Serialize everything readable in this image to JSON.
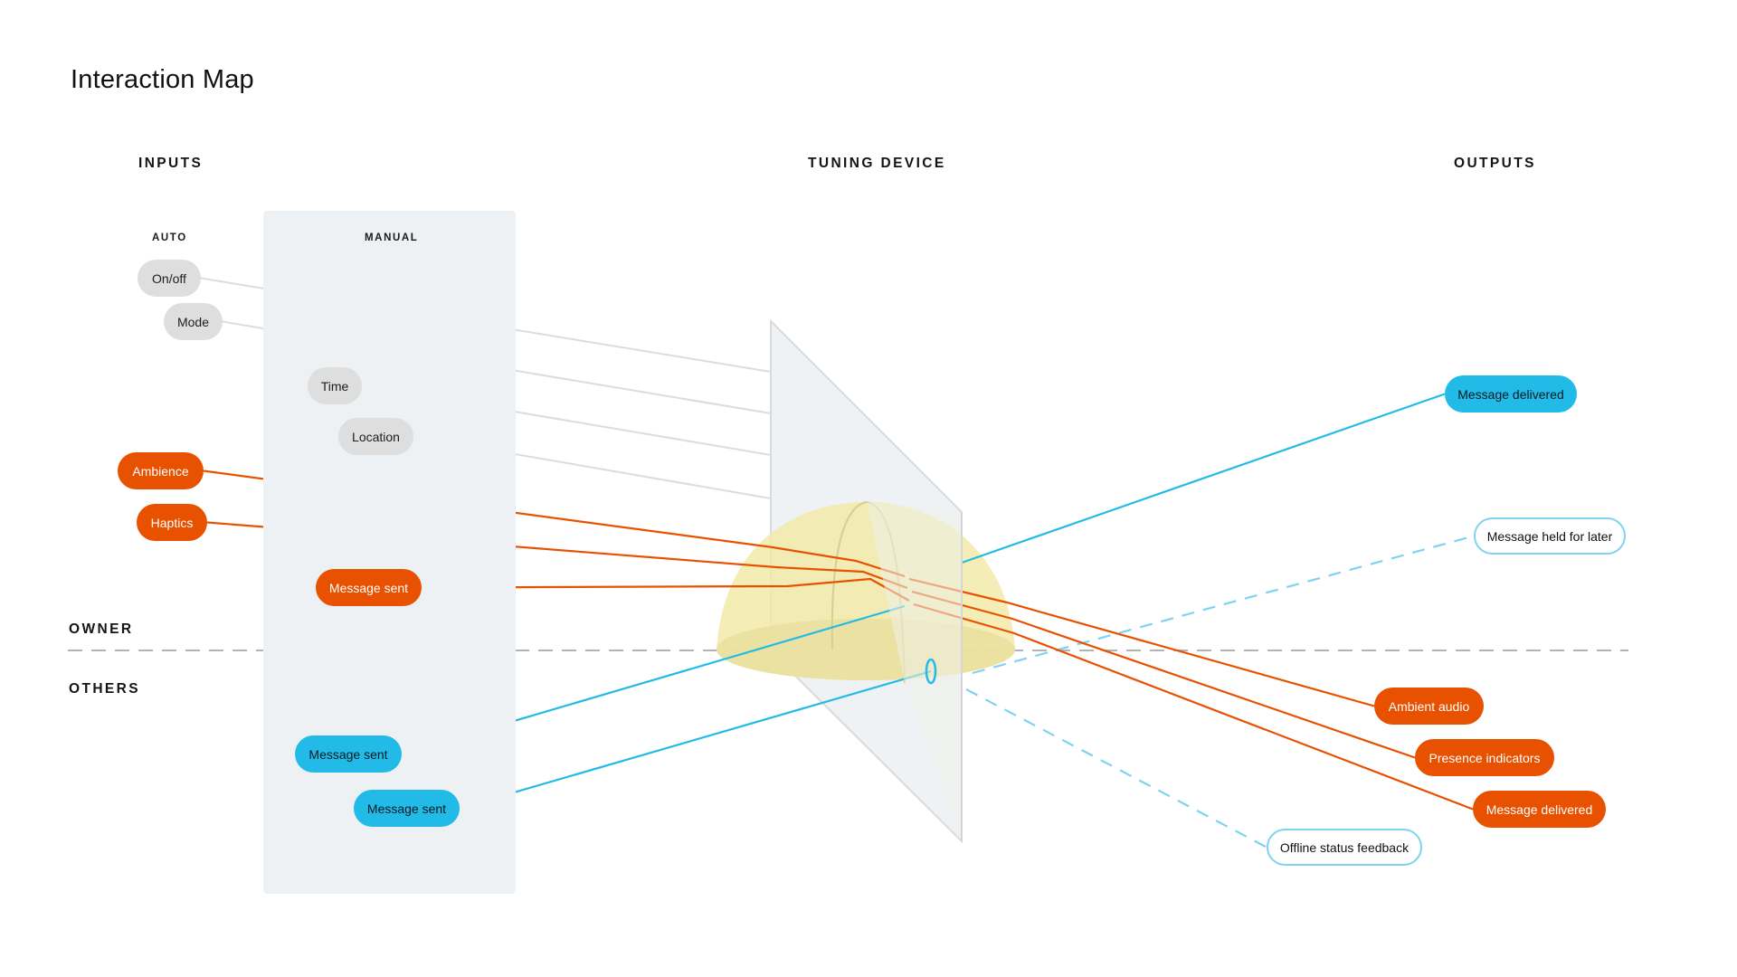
{
  "title": "Interaction Map",
  "sections": {
    "inputs": "INPUTS",
    "tuning_device": "TUNING DEVICE",
    "outputs": "OUTPUTS"
  },
  "input_groups": {
    "auto": "AUTO",
    "manual": "MANUAL"
  },
  "lanes": {
    "owner": "OWNER",
    "others": "OTHERS"
  },
  "colors": {
    "owner_signal": "#e85100",
    "others_signal": "#22bbe8",
    "setting": "#dedede",
    "deferred_outline": "#7dd3f0",
    "device_dome": "#f2eaa8",
    "manual_panel": "#edf1f3"
  },
  "inputs": [
    {
      "id": "on-off",
      "label": "On/off",
      "group": "auto",
      "lane": "owner",
      "kind": "setting"
    },
    {
      "id": "mode",
      "label": "Mode",
      "group": "auto",
      "lane": "owner",
      "kind": "setting"
    },
    {
      "id": "time",
      "label": "Time",
      "group": "manual",
      "lane": "owner",
      "kind": "setting"
    },
    {
      "id": "location",
      "label": "Location",
      "group": "manual",
      "lane": "owner",
      "kind": "setting"
    },
    {
      "id": "ambience",
      "label": "Ambience",
      "group": "auto",
      "lane": "owner",
      "kind": "owner_signal"
    },
    {
      "id": "haptics",
      "label": "Haptics",
      "group": "auto",
      "lane": "owner",
      "kind": "owner_signal"
    },
    {
      "id": "owner-message-sent",
      "label": "Message sent",
      "group": "manual",
      "lane": "owner",
      "kind": "owner_signal"
    },
    {
      "id": "others-message-sent-1",
      "label": "Message sent",
      "group": "manual",
      "lane": "others",
      "kind": "others_signal"
    },
    {
      "id": "others-message-sent-2",
      "label": "Message sent",
      "group": "manual",
      "lane": "others",
      "kind": "others_signal"
    }
  ],
  "outputs": [
    {
      "id": "message-delivered-blue",
      "label": "Message delivered",
      "kind": "others_signal",
      "line": "solid"
    },
    {
      "id": "message-held",
      "label": "Message held for later",
      "kind": "deferred",
      "line": "dashed"
    },
    {
      "id": "ambient-audio",
      "label": "Ambient audio",
      "kind": "owner_signal",
      "line": "solid"
    },
    {
      "id": "presence-indicators",
      "label": "Presence indicators",
      "kind": "owner_signal",
      "line": "solid"
    },
    {
      "id": "message-delivered-orange",
      "label": "Message delivered",
      "kind": "owner_signal",
      "line": "solid"
    },
    {
      "id": "offline-status",
      "label": "Offline status feedback",
      "kind": "deferred",
      "line": "dashed"
    }
  ]
}
